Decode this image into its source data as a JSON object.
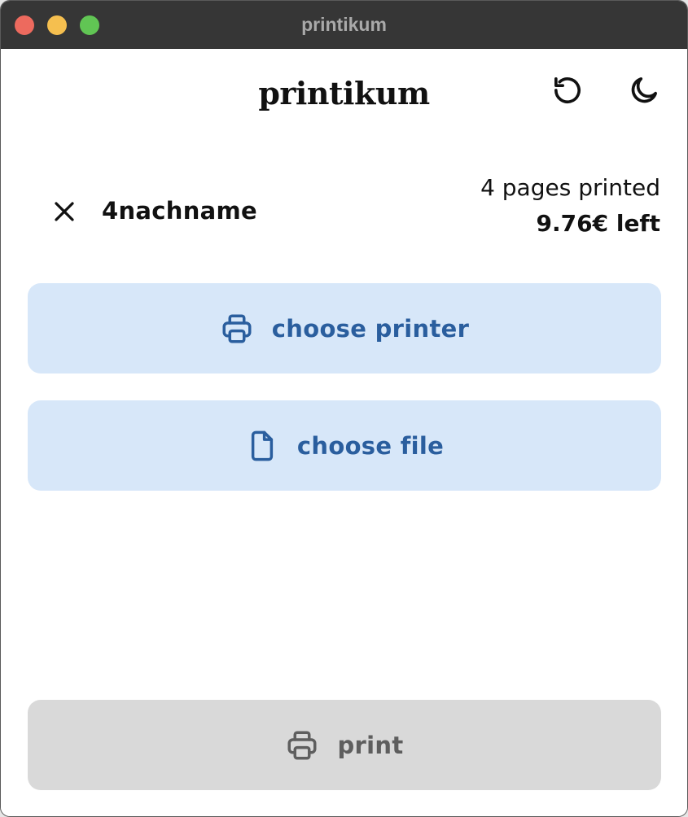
{
  "window": {
    "title": "printikum",
    "controls": [
      "close",
      "minimize",
      "maximize"
    ]
  },
  "header": {
    "app_title": "printikum",
    "refresh_icon": "refresh-icon",
    "theme_icon": "moon-icon"
  },
  "user": {
    "logout_icon": "close-icon",
    "username": "4nachname",
    "pages_printed": "4 pages printed",
    "balance": "9.76€ left"
  },
  "actions": {
    "choose_printer": {
      "label": "choose printer",
      "icon": "printer-icon"
    },
    "choose_file": {
      "label": "choose file",
      "icon": "file-icon"
    },
    "print": {
      "label": "print",
      "icon": "printer-icon",
      "state": "disabled"
    }
  },
  "colors": {
    "action_bg": "#d7e7f9",
    "action_fg": "#2a5e9e",
    "print_bg": "#d9d9d9",
    "print_fg": "#5e5e5e"
  }
}
